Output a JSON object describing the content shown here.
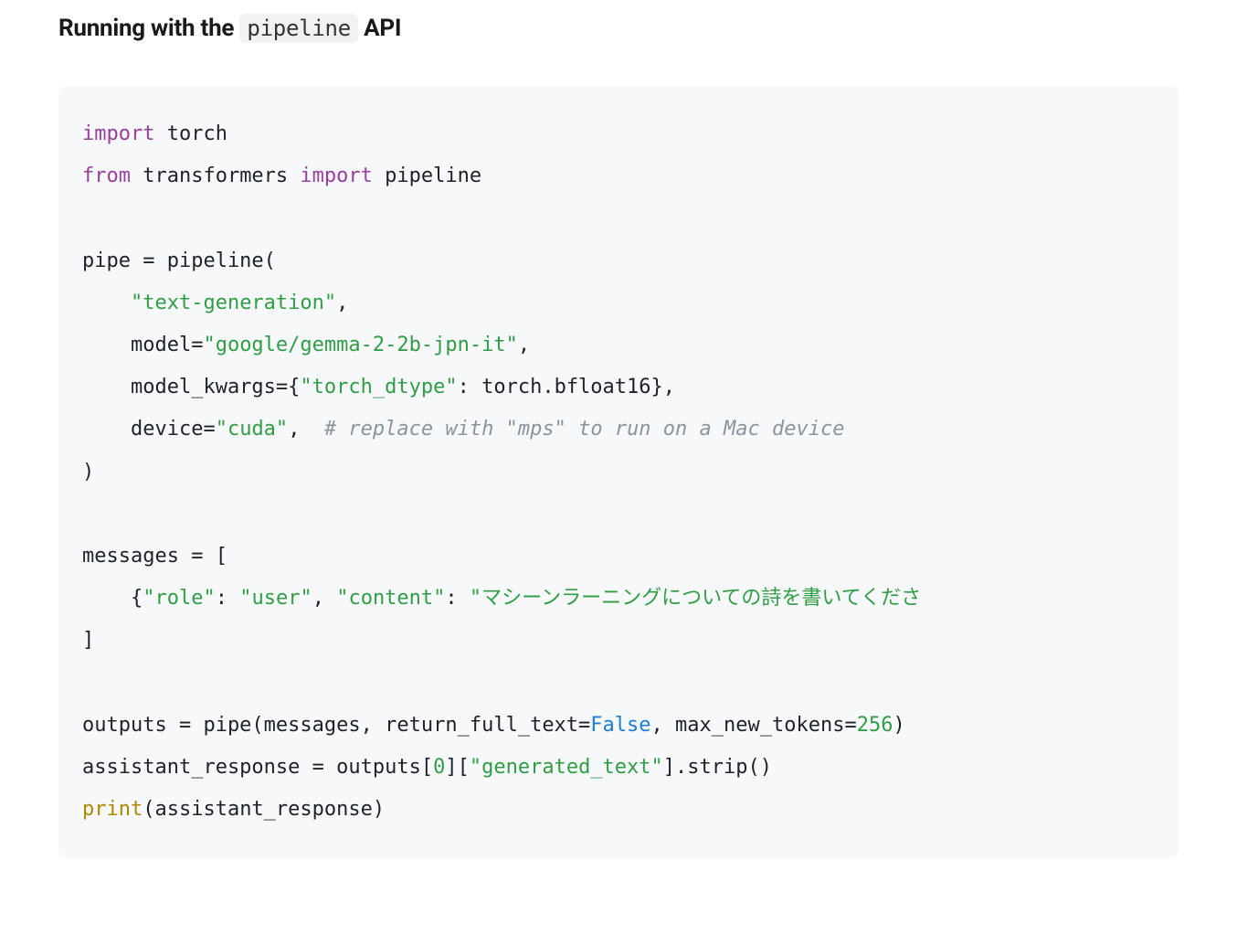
{
  "heading": {
    "pre": "Running with the ",
    "code": "pipeline",
    "post": " API"
  },
  "code": {
    "l1_kw1": "import",
    "l1_sp": " torch",
    "l2_kw1": "from",
    "l2_txt1": " transformers ",
    "l2_kw2": "import",
    "l2_txt2": " pipeline",
    "l3_txt": "pipe = pipeline(",
    "l4_pad": "    ",
    "l4_str": "\"text-generation\"",
    "l4_comma": ",",
    "l5_pad": "    model=",
    "l5_str": "\"google/gemma-2-2b-jpn-it\"",
    "l5_comma": ",",
    "l6_pad": "    model_kwargs={",
    "l6_str": "\"torch_dtype\"",
    "l6_rest": ": torch.bfloat16},",
    "l7_pad": "    device=",
    "l7_str": "\"cuda\"",
    "l7_comma": ",  ",
    "l7_cmt": "# replace with \"mps\" to run on a Mac device",
    "l8_txt": ")",
    "l9_txt": "messages = [",
    "l10_pad": "    {",
    "l10_str_role_k": "\"role\"",
    "l10_colon1": ": ",
    "l10_str_role_v": "\"user\"",
    "l10_c1": ", ",
    "l10_str_content_k": "\"content\"",
    "l10_colon2": ": ",
    "l10_str_content_v": "\"マシーンラーニングについての詩を書いてくださ",
    "l11_txt": "]",
    "l12_a": "outputs = pipe(messages, return_full_text=",
    "l12_bool": "False",
    "l12_b": ", max_new_tokens=",
    "l12_num": "256",
    "l12_c": ")",
    "l13_a": "assistant_response = outputs[",
    "l13_num": "0",
    "l13_b": "][",
    "l13_str": "\"generated_text\"",
    "l13_c": "].strip()",
    "l14_fn": "print",
    "l14_rest": "(assistant_response)"
  }
}
